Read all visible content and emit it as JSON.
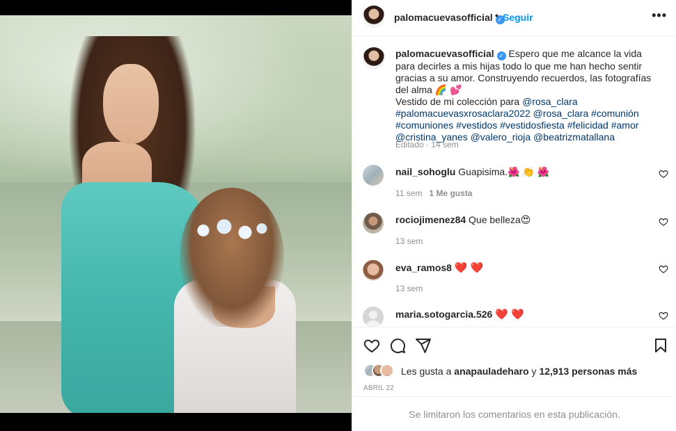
{
  "post": {
    "username": "palomacuevasofficial",
    "follow_label": "Seguir",
    "more_label": "•••",
    "dot": "•"
  },
  "caption": {
    "username": "palomacuevasofficial",
    "text1": "Espero que me alcance la vida para decirles a mis hijas todo lo que me han hecho sentir gracias a su amor. Construyendo recuerdos, las fotografías del alma 🌈 💕",
    "text2": "Vestido de mi colección para ",
    "mention_rosa": "@rosa_clara",
    "tags": "#palomacuevasxrosaclara2022 @rosa_clara #comunión #comuniones #vestidos #vestidosfiesta #felicidad #amor @cristina_yanes @valero_rioja @beatrizmatallana",
    "meta": "Editado · 14 sem"
  },
  "comments": [
    {
      "user": "nail_sohoglu",
      "text": "Guapisima.🌺 👏 🌺",
      "time": "11 sem",
      "likes": "1 Me gusta"
    },
    {
      "user": "rociojimenez84",
      "text": "Que belleza😍",
      "time": "13 sem",
      "likes": ""
    },
    {
      "user": "eva_ramos8",
      "text": "❤️ ❤️",
      "time": "13 sem",
      "likes": ""
    },
    {
      "user": "maria.sotogarcia.526",
      "text": "❤️ ❤️",
      "time": "",
      "likes": ""
    }
  ],
  "likes": {
    "prefix": "Les gusta a ",
    "user": "anapauladeharo",
    "middle": " y ",
    "count": "12,913 personas más"
  },
  "date": "ABRIL 22",
  "limited": "Se limitaron los comentarios en esta publicación.",
  "colors": {
    "accent": "#0095f6",
    "verified": "#3897f0",
    "muted": "#8e8e8e",
    "heart": "#e0245e"
  }
}
